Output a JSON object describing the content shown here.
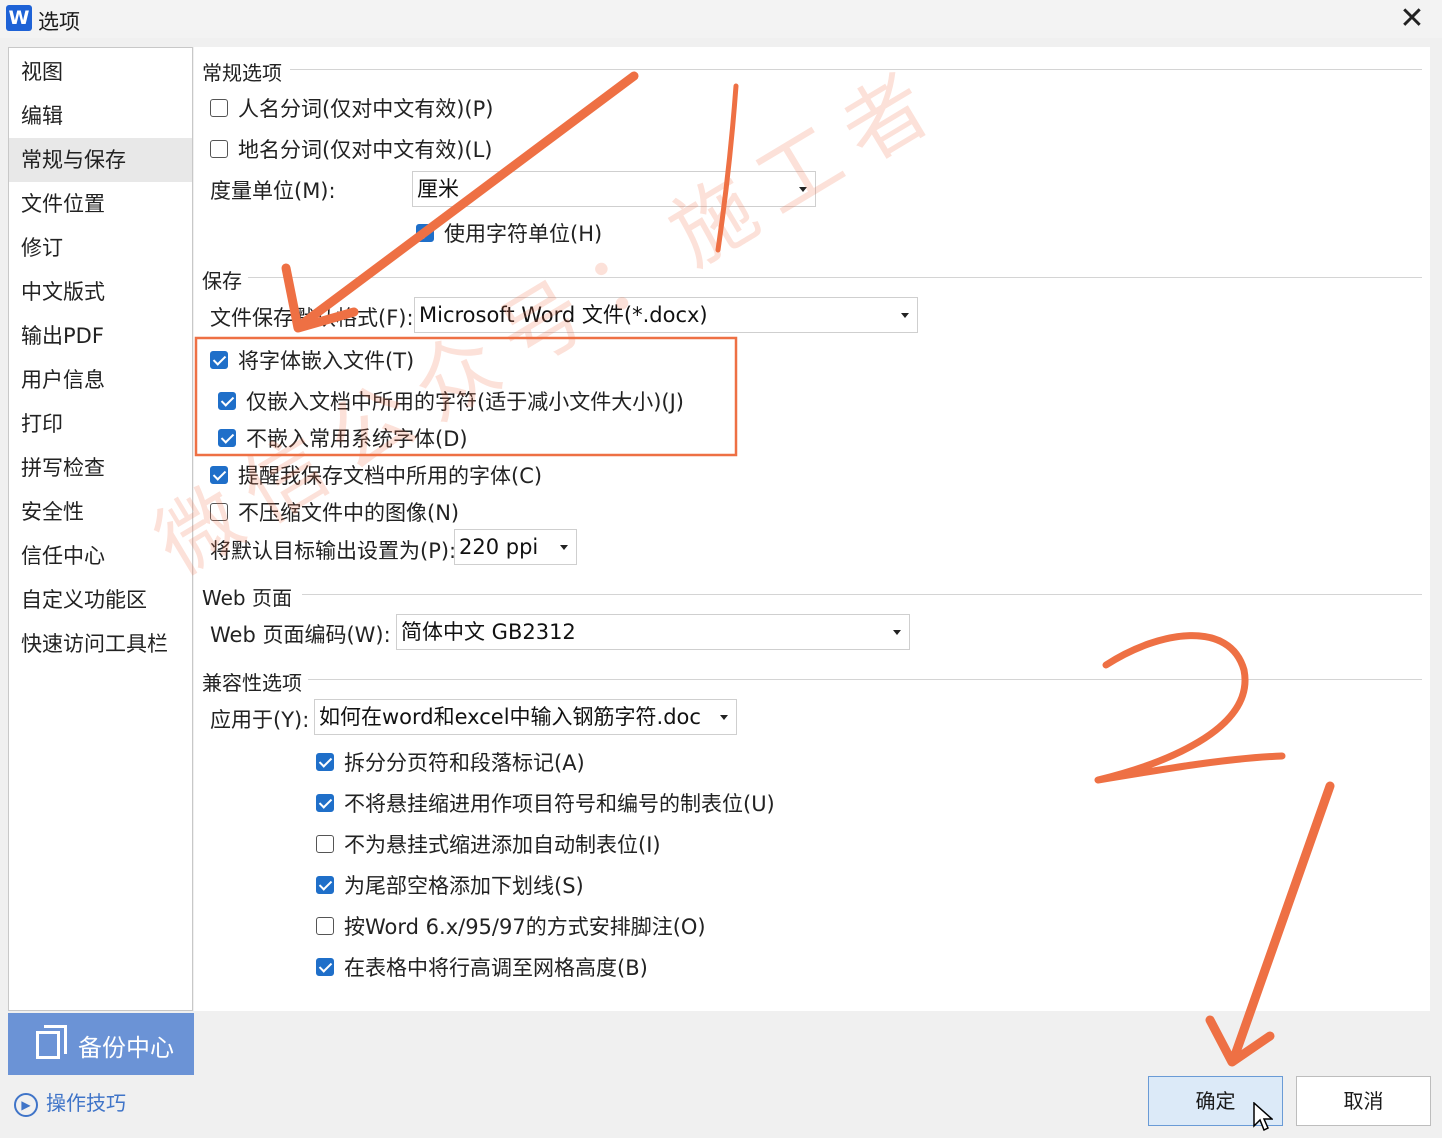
{
  "window": {
    "app_icon_letter": "W",
    "title": "选项",
    "close_symbol": "✕"
  },
  "sidebar": {
    "items": [
      {
        "label": "视图"
      },
      {
        "label": "编辑"
      },
      {
        "label": "常规与保存",
        "active": true
      },
      {
        "label": "文件位置"
      },
      {
        "label": "修订"
      },
      {
        "label": "中文版式"
      },
      {
        "label": "输出PDF"
      },
      {
        "label": "用户信息"
      },
      {
        "label": "打印"
      },
      {
        "label": "拼写检查"
      },
      {
        "label": "安全性"
      },
      {
        "label": "信任中心"
      },
      {
        "label": "自定义功能区"
      },
      {
        "label": "快速访问工具栏"
      }
    ],
    "backup_label": "备份中心",
    "tips_label": "操作技巧"
  },
  "general": {
    "title": "常规选项",
    "person_name_seg": {
      "label": "人名分词(仅对中文有效)(P)",
      "checked": false
    },
    "place_name_seg": {
      "label": "地名分词(仅对中文有效)(L)",
      "checked": false
    },
    "unit_label": "度量单位(M):",
    "unit_value": "厘米",
    "char_unit": {
      "label": "使用字符单位(H)",
      "checked": true
    }
  },
  "save": {
    "title": "保存",
    "format_label": "文件保存默认格式(F):",
    "format_value": "Microsoft Word 文件(*.docx)",
    "embed_fonts": {
      "label": "将字体嵌入文件(T)",
      "checked": true
    },
    "embed_used_only": {
      "label": "仅嵌入文档中所用的字符(适于减小文件大小)(J)",
      "checked": true
    },
    "no_system_fonts": {
      "label": "不嵌入常用系统字体(D)",
      "checked": true
    },
    "remind_fonts": {
      "label": "提醒我保存文档中所用的字体(C)",
      "checked": true
    },
    "no_compress": {
      "label": "不压缩文件中的图像(N)",
      "checked": false
    },
    "output_label": "将默认目标输出设置为(P):",
    "output_value": "220 ppi"
  },
  "web": {
    "title": "Web 页面",
    "encoding_label": "Web 页面编码(W):",
    "encoding_value": "简体中文 GB2312"
  },
  "compat": {
    "title": "兼容性选项",
    "apply_label": "应用于(Y):",
    "apply_value": "如何在word和excel中输入钢筋字符.doc",
    "options": [
      {
        "label": "拆分分页符和段落标记(A)",
        "checked": true
      },
      {
        "label": "不将悬挂缩进用作项目符号和编号的制表位(U)",
        "checked": true
      },
      {
        "label": "不为悬挂式缩进添加自动制表位(I)",
        "checked": false
      },
      {
        "label": "为尾部空格添加下划线(S)",
        "checked": true
      },
      {
        "label": "按Word 6.x/95/97的方式安排脚注(O)",
        "checked": false
      },
      {
        "label": "在表格中将行高调至网格高度(B)",
        "checked": true
      }
    ]
  },
  "footer": {
    "ok_label": "确定",
    "cancel_label": "取消"
  },
  "annotations": {
    "watermark": "微信公众号：施工者",
    "accent_color": "#ee7044"
  }
}
